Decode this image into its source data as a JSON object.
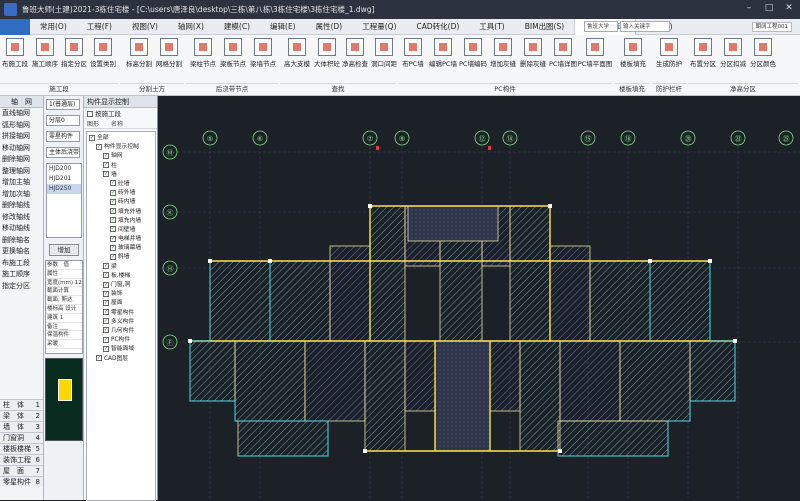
{
  "title": "鲁班大师(土建)2021-3栋住宅楼 - [C:\\users\\唐泽良\\desktop\\三栋\\第八栋\\3栋住宅楼\\3栋住宅楼_1.dwg]",
  "menus": [
    "常用(O)",
    "工程(F)",
    "视图(V)",
    "轴网(X)",
    "建模(C)",
    "编辑(E)",
    "属性(D)",
    "工程量(Q)",
    "CAD转化(D)",
    "工具(T)",
    "BIM出图(S)",
    "BIM应用(B)",
    "帮助(H)"
  ],
  "active_menu": "BIM应用(B)",
  "search": {
    "scope": "鲁班大学",
    "placeholder": "输入关键字"
  },
  "user": "朝阔工程001",
  "ribbon_buttons": [
    "布施工段",
    "施工顺序",
    "指定分区",
    "设置类别",
    "标高分割",
    "网格分割",
    "梁柱节点",
    "梁板节点",
    "梁墙节点",
    "高大支模",
    "大体积砼",
    "净高检查",
    "洞口间距",
    "布PC墙",
    "编辑PC墙",
    "PC墙编码",
    "增加灰缝",
    "删除灰缝",
    "PC墙详图",
    "PC墙平面图",
    "楼板填充",
    "生成防护",
    "布置分区",
    "分区扣减",
    "分区颜色"
  ],
  "ribbon_groups": [
    "施工段",
    "分割土方",
    "后浇带节点",
    "查找",
    "PC构件",
    "楼板填充",
    "防护栏杆",
    "净高分区"
  ],
  "left_panel": {
    "header": "轴　网",
    "items": [
      "直线轴网",
      "弧形轴网",
      "拼接轴网",
      "移动轴网",
      "删除轴网",
      "整理轴网",
      "增加主轴",
      "增加次轴",
      "删除轴线",
      "修改轴线",
      "移动轴线",
      "删除轴名",
      "更换轴名",
      "布施工段",
      "施工顺序",
      "指定分区"
    ],
    "categories": [
      "柱　体",
      "梁　体",
      "墙　体",
      "门窗洞",
      "楼板楼梯",
      "装饰工程",
      "屋　面",
      "零星构件"
    ],
    "category_nums": [
      "1",
      "2",
      "3",
      "4",
      "5",
      "6",
      "7",
      "8"
    ]
  },
  "mid_panel": {
    "dropdowns": [
      "1(普通层)",
      "分层0",
      "零星构件",
      "主体后浇带"
    ],
    "list": [
      "HJD200",
      "HJD201",
      "HJD250"
    ],
    "selected": "HJD250",
    "ok": "增加",
    "props_header": "参数",
    "props_col": "值",
    "props": [
      "属性",
      "宽度(mm) 1200",
      "截面计算",
      "截面, 斯达",
      "楼标高 设计",
      "建筑 1",
      "备注 ___",
      "保温构件",
      "采暖",
      "修改 ___"
    ]
  },
  "tree_panel": {
    "title": "构件显示控制",
    "option": "按施工段",
    "col_left": "图形",
    "col_right": "名称",
    "nodes": [
      {
        "label": "全部",
        "level": 0
      },
      {
        "label": "构件显示控制",
        "level": 1
      },
      {
        "label": "轴网",
        "level": 2
      },
      {
        "label": "柱",
        "level": 2
      },
      {
        "label": "墙",
        "level": 2
      },
      {
        "label": "砼墙",
        "level": 3
      },
      {
        "label": "砖外墙",
        "level": 3
      },
      {
        "label": "砖内墙",
        "level": 3
      },
      {
        "label": "填充外墙",
        "level": 3
      },
      {
        "label": "填充内墙",
        "level": 3
      },
      {
        "label": "间壁墙",
        "level": 3
      },
      {
        "label": "电梯井墙",
        "level": 3
      },
      {
        "label": "玻璃幕墙",
        "level": 3
      },
      {
        "label": "斜墙",
        "level": 3
      },
      {
        "label": "梁",
        "level": 2
      },
      {
        "label": "板,楼梯",
        "level": 2
      },
      {
        "label": "门窗,洞",
        "level": 2
      },
      {
        "label": "装饰",
        "level": 2
      },
      {
        "label": "屋面",
        "level": 2
      },
      {
        "label": "零星构件",
        "level": 2
      },
      {
        "label": "多义构件",
        "level": 2
      },
      {
        "label": "几何构件",
        "level": 2
      },
      {
        "label": "PC构件",
        "level": 2
      },
      {
        "label": "智能面域",
        "level": 2
      },
      {
        "label": "CAD图层",
        "level": 1
      }
    ]
  },
  "axis_top": [
    "⑤",
    "⑥",
    "⑦",
    "⑨",
    "⑫",
    "⑭",
    "⑮",
    "⑱",
    "⑳",
    "㉓",
    "㉕"
  ],
  "axis_left": [
    "Ⓜ",
    "Ⓚ",
    "Ⓗ",
    "Ⓕ"
  ]
}
